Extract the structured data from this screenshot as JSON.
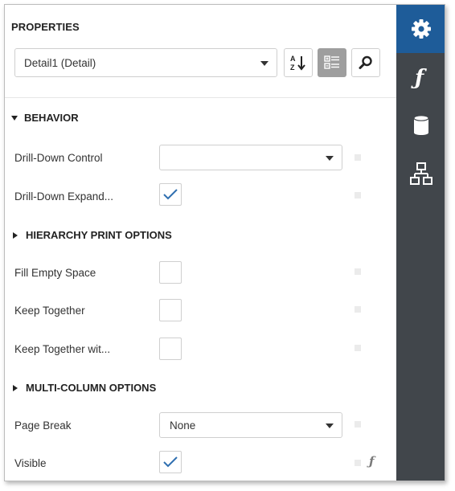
{
  "panel": {
    "title": "PROPERTIES",
    "selected_component": "Detail1 (Detail)",
    "toolbar": [
      {
        "icon": "sort-alphabetical-icon",
        "pressed": false
      },
      {
        "icon": "categorized-view-icon",
        "pressed": true
      },
      {
        "icon": "search-icon",
        "pressed": false
      }
    ]
  },
  "tabs": [
    {
      "icon": "gear-icon",
      "active": true
    },
    {
      "icon": "function-icon",
      "active": false
    },
    {
      "icon": "database-icon",
      "active": false
    },
    {
      "icon": "report-explorer-icon",
      "active": false
    }
  ],
  "groups": {
    "behavior": {
      "title": "BEHAVIOR",
      "expanded": true,
      "properties": {
        "drill_down_control": {
          "label": "Drill-Down Control",
          "value": ""
        },
        "drill_down_expanded": {
          "label": "Drill-Down Expand...",
          "checked": true
        }
      }
    },
    "hierarchy": {
      "title": "HIERARCHY PRINT OPTIONS",
      "expanded": false
    },
    "layout": {
      "properties": {
        "fill_empty_space": {
          "label": "Fill Empty Space",
          "checked": false
        },
        "keep_together": {
          "label": "Keep Together",
          "checked": false
        },
        "keep_together_with": {
          "label": "Keep Together wit...",
          "checked": false
        }
      }
    },
    "multicolumn": {
      "title": "MULTI-COLUMN OPTIONS",
      "expanded": false,
      "properties": {
        "page_break": {
          "label": "Page Break",
          "value": "None"
        },
        "visible": {
          "label": "Visible",
          "checked": true,
          "has_expression": true
        }
      }
    }
  },
  "colors": {
    "tab_strip": "#41464b",
    "active_tab": "#1e5c99",
    "check_mark": "#2f6fb0"
  }
}
